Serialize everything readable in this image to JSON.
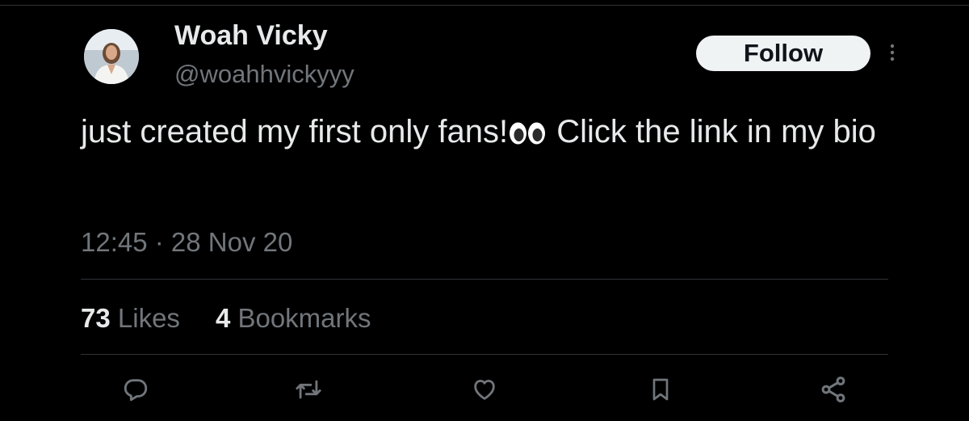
{
  "tweet": {
    "author": {
      "display_name": "Woah Vicky",
      "handle": "@woahhvickyyy",
      "avatar_icon": "avatar-photo"
    },
    "follow_label": "Follow",
    "more_icon": "more-vertical-icon",
    "text_before_emoji": "just created my first only fans!",
    "emoji": "eyes-emoji",
    "text_after_emoji": " Click the link in my bio",
    "timestamp": "12:45 · 28 Nov 20",
    "stats": {
      "likes_count": "73",
      "likes_label": " Likes",
      "bookmarks_count": "4",
      "bookmarks_label": " Bookmarks"
    },
    "actions": [
      "reply-icon",
      "retweet-icon",
      "like-icon",
      "bookmark-icon",
      "share-icon"
    ]
  },
  "colors": {
    "background": "#000000",
    "text_primary": "#e7e9ea",
    "text_secondary": "#71767b",
    "divider": "#2f3336",
    "follow_bg": "#eff3f4",
    "follow_text": "#0f1419"
  }
}
